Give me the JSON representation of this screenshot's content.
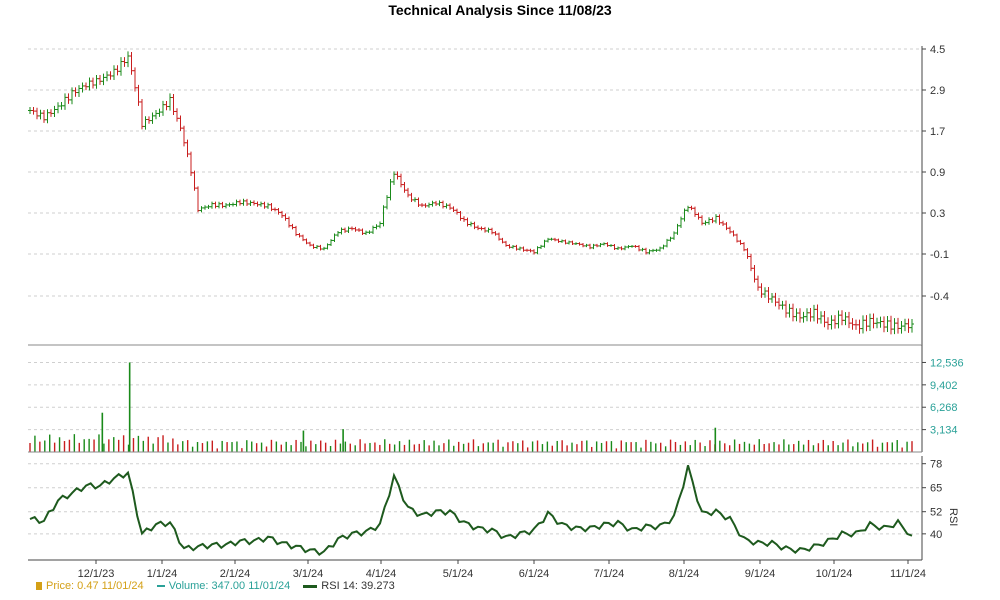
{
  "chart_data": {
    "type": "candlestick",
    "title": "Technical Analysis Since 11/08/23",
    "x_tick_labels": [
      "12/1/23",
      "1/1/24",
      "2/1/24",
      "3/1/24",
      "4/1/24",
      "5/1/24",
      "6/1/24",
      "7/1/24",
      "8/1/24",
      "9/1/24",
      "10/1/24",
      "11/1/24"
    ],
    "price_panel": {
      "y_tick_labels": [
        "4.5",
        "2.9",
        "1.7",
        "0.9",
        "0.3",
        "-0.1",
        "-0.4"
      ],
      "close_series": [
        2.3,
        2.1,
        2.4,
        2.8,
        3.1,
        3.3,
        3.6,
        4.2,
        1.9,
        2.2,
        2.6,
        1.5,
        0.35,
        0.42,
        0.41,
        0.46,
        0.44,
        0.4,
        0.28,
        0.1,
        -0.02,
        -0.05,
        0.12,
        0.15,
        0.1,
        0.2,
        0.9,
        0.55,
        0.4,
        0.45,
        0.38,
        0.22,
        0.15,
        0.12,
        -0.02,
        -0.05,
        -0.08,
        0.05,
        0.02,
        0.0,
        -0.03,
        0.0,
        -0.05,
        -0.02,
        -0.08,
        -0.05,
        0.1,
        0.4,
        0.2,
        0.25,
        0.12,
        -0.05,
        -0.35,
        -0.42,
        -0.5,
        -0.55,
        -0.52,
        -0.6,
        -0.55,
        -0.62,
        -0.58,
        -0.6,
        -0.62,
        -0.6
      ]
    },
    "volume_panel": {
      "y_tick_labels": [
        "12,536",
        "9,402",
        "6,268",
        "3,134"
      ],
      "ylim": [
        0,
        14000
      ],
      "spikes": [
        {
          "x_frac": 0.082,
          "value": 5500
        },
        {
          "x_frac": 0.113,
          "value": 12536
        },
        {
          "x_frac": 0.31,
          "value": 3000
        },
        {
          "x_frac": 0.355,
          "value": 3200
        },
        {
          "x_frac": 0.777,
          "value": 3400
        }
      ]
    },
    "rsi_panel": {
      "label": "RSI",
      "y_tick_labels": [
        "78",
        "65",
        "52",
        "40"
      ],
      "ylim": [
        28,
        80
      ],
      "values": [
        48,
        47,
        58,
        62,
        66,
        66,
        70,
        73,
        40,
        45,
        46,
        32,
        33,
        34,
        34,
        36,
        36,
        38,
        35,
        33,
        31,
        30,
        37,
        40,
        41,
        45,
        71,
        54,
        50,
        52,
        52,
        46,
        43,
        42,
        38,
        40,
        42,
        51,
        45,
        43,
        43,
        45,
        46,
        42,
        44,
        44,
        49,
        76,
        51,
        52,
        48,
        37,
        35,
        35,
        32,
        31,
        33,
        36,
        40,
        40,
        45,
        43,
        46,
        39
      ]
    },
    "legend": {
      "price": "Price: 0.47  11/01/24",
      "volume": "Volume: 347.00  11/01/24",
      "rsi": "RSI 14: 39.273"
    }
  }
}
